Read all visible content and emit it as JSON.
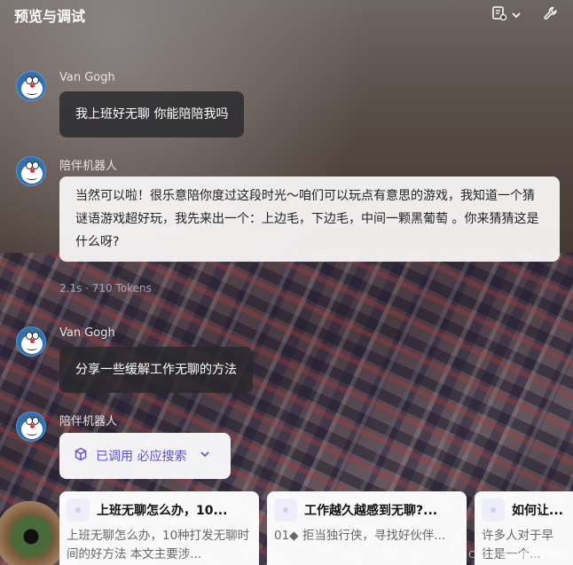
{
  "header": {
    "title": "预览与调试",
    "icons": [
      "document-settings-icon",
      "chevron-down-icon",
      "wrench-icon"
    ]
  },
  "messages": [
    {
      "sender": "Van Gogh",
      "text": "我上班好无聊 你能陪陪我吗"
    },
    {
      "sender": "陪伴机器人",
      "text": "当然可以啦！很乐意陪你度过这段时光～咱们可以玩点有意思的游戏，我知道一个猜谜语游戏超好玩，我先来出一个：上边毛，下边毛，中间一颗黑葡萄 。你来猜猜这是什么呀?"
    },
    {
      "sender": "Van Gogh",
      "text": "分享一些缓解工作无聊的方法"
    },
    {
      "sender": "陪伴机器人"
    }
  ],
  "meta": {
    "stats": "2.1s · 710 Tokens"
  },
  "search_pill": {
    "label": "已调用 必应搜索"
  },
  "cards": [
    {
      "title": "上班无聊怎么办，10...",
      "snippet": "上班无聊怎么办，10种打发无聊时间的好方法 本文主要涉..."
    },
    {
      "title": "工作越久越感到无聊?...",
      "snippet": "01◆ 拒当独行侠，寻找好伙伴..."
    },
    {
      "title": "如何让...",
      "snippet": "许多人对于早 往是一个..."
    }
  ],
  "watermark": "CSDN @爱编程的喵喵"
}
